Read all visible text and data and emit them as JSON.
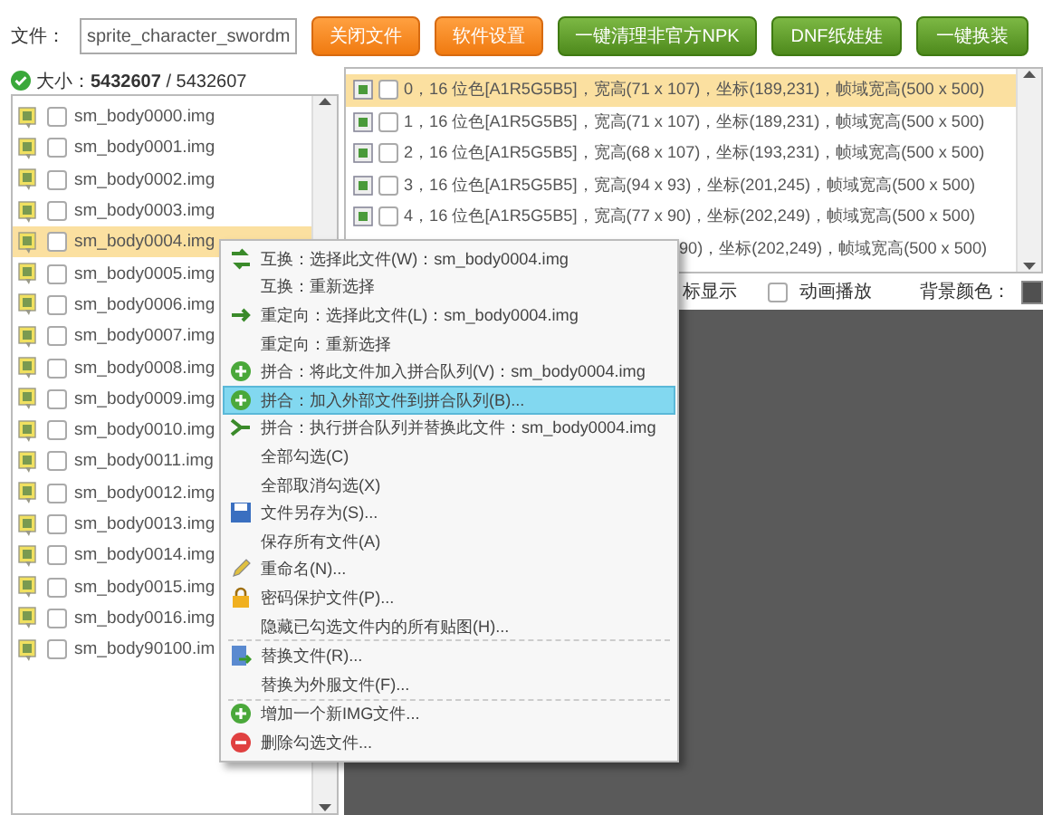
{
  "toolbar": {
    "file_label": "文件：",
    "file_value": "sprite_character_swordm",
    "buttons": [
      {
        "label": "关闭文件",
        "kind": "orange"
      },
      {
        "label": "软件设置",
        "kind": "orange"
      },
      {
        "label": "一键清理非官方NPK",
        "kind": "green"
      },
      {
        "label": "DNF纸娃娃",
        "kind": "green"
      },
      {
        "label": "一键换装",
        "kind": "green"
      }
    ]
  },
  "size_text": "大小：**5432607** / 5432607",
  "file_list": [
    {
      "name": "sm_body0000.img",
      "checked": false,
      "selected": false
    },
    {
      "name": "sm_body0001.img",
      "checked": false,
      "selected": false
    },
    {
      "name": "sm_body0002.img",
      "checked": false,
      "selected": false
    },
    {
      "name": "sm_body0003.img",
      "checked": false,
      "selected": false
    },
    {
      "name": "sm_body0004.img",
      "checked": false,
      "selected": true
    },
    {
      "name": "sm_body0005.img",
      "checked": false,
      "selected": false
    },
    {
      "name": "sm_body0006.img",
      "checked": false,
      "selected": false
    },
    {
      "name": "sm_body0007.img",
      "checked": false,
      "selected": false
    },
    {
      "name": "sm_body0008.img",
      "checked": false,
      "selected": false
    },
    {
      "name": "sm_body0009.img",
      "checked": false,
      "selected": false
    },
    {
      "name": "sm_body0010.img",
      "checked": false,
      "selected": false
    },
    {
      "name": "sm_body0011.img",
      "checked": false,
      "selected": false
    },
    {
      "name": "sm_body0012.img",
      "checked": false,
      "selected": false
    },
    {
      "name": "sm_body0013.img",
      "checked": false,
      "selected": false
    },
    {
      "name": "sm_body0014.img",
      "checked": false,
      "selected": false
    },
    {
      "name": "sm_body0015.img",
      "checked": false,
      "selected": false
    },
    {
      "name": "sm_body0016.img",
      "checked": false,
      "selected": false
    },
    {
      "name": "sm_body90100.im",
      "checked": false,
      "selected": false
    }
  ],
  "frame_list": [
    {
      "text": "0，16 位色[A1R5G5B5]，宽高(71 x 107)，坐标(189,231)，帧域宽高(500 x 500)",
      "checked": false,
      "selected": true
    },
    {
      "text": "1，16 位色[A1R5G5B5]，宽高(71 x 107)，坐标(189,231)，帧域宽高(500 x 500)",
      "checked": false,
      "selected": false
    },
    {
      "text": "2，16 位色[A1R5G5B5]，宽高(68 x 107)，坐标(193,231)，帧域宽高(500 x 500)",
      "checked": false,
      "selected": false
    },
    {
      "text": "3，16 位色[A1R5G5B5]，宽高(94 x 93)，坐标(201,245)，帧域宽高(500 x 500)",
      "checked": false,
      "selected": false
    },
    {
      "text": "4，16 位色[A1R5G5B5]，宽高(77 x 90)，坐标(202,249)，帧域宽高(500 x 500)",
      "checked": false,
      "selected": false
    }
  ],
  "frame_partial_row": "90)，坐标(202,249)，帧域宽高(500 x 500)",
  "options": {
    "coord_label": "标显示",
    "animate_label": "动画播放",
    "animate_checked": false,
    "bg_label": "背景颜色："
  },
  "context_menu": [
    {
      "label": "互换：选择此文件(W)：sm_body0004.img",
      "kind": "swap",
      "selected": false
    },
    {
      "label": "互换：重新选择",
      "kind": "plain",
      "selected": false
    },
    {
      "label": "重定向：选择此文件(L)：sm_body0004.img",
      "kind": "arrow",
      "selected": false
    },
    {
      "label": "重定向：重新选择",
      "kind": "plain",
      "selected": false
    },
    {
      "label": "拼合：将此文件加入拼合队列(V)：sm_body0004.img",
      "kind": "plus",
      "selected": false
    },
    {
      "label": "拼合：加入外部文件到拼合队列(B)...",
      "kind": "plus",
      "selected": true
    },
    {
      "label": "拼合：执行拼合队列并替换此文件：sm_body0004.img",
      "kind": "merge",
      "selected": false
    },
    {
      "label": "全部勾选(C)",
      "kind": "plain",
      "selected": false
    },
    {
      "label": "全部取消勾选(X)",
      "kind": "plain",
      "selected": false
    },
    {
      "label": "文件另存为(S)...",
      "kind": "save",
      "selected": false
    },
    {
      "label": "保存所有文件(A)",
      "kind": "plain",
      "selected": false
    },
    {
      "label": "重命名(N)...",
      "kind": "pencil",
      "selected": false
    },
    {
      "label": "密码保护文件(P)...",
      "kind": "lock",
      "selected": false
    },
    {
      "label": "隐藏已勾选文件内的所有贴图(H)...",
      "kind": "plain",
      "selected": false
    },
    {
      "kind": "separator"
    },
    {
      "label": "替换文件(R)...",
      "kind": "replace",
      "selected": false
    },
    {
      "label": "替换为外服文件(F)...",
      "kind": "plain",
      "selected": false
    },
    {
      "kind": "separator"
    },
    {
      "label": "增加一个新IMG文件...",
      "kind": "plus",
      "selected": false
    },
    {
      "label": "删除勾选文件...",
      "kind": "minus",
      "selected": false
    }
  ]
}
